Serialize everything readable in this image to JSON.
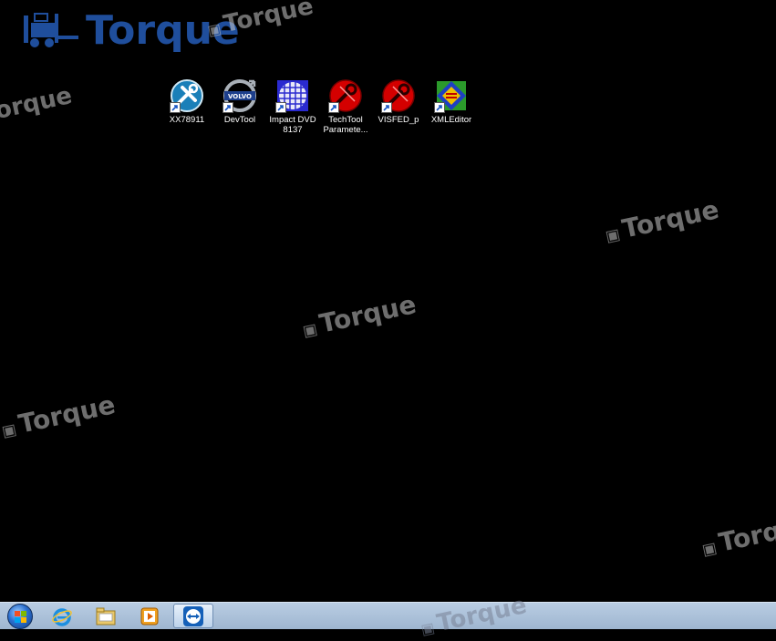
{
  "desktop": {
    "icons": [
      {
        "label": "XX78911",
        "icon": "tools-icon"
      },
      {
        "label": "DevTool",
        "icon": "volvo-icon",
        "badge": "VOLVO"
      },
      {
        "label": "Impact DVD 8137",
        "icon": "grid-globe-icon"
      },
      {
        "label": "TechTool Paramete...",
        "icon": "red-wrench-icon"
      },
      {
        "label": "VISFED_p",
        "icon": "red-wrench-icon"
      },
      {
        "label": "XMLEditor",
        "icon": "xml-editor-icon"
      }
    ]
  },
  "watermark": {
    "text": "Torque",
    "logo_text": "Torque"
  },
  "taskbar": {
    "pinned": [
      {
        "name": "start-orb-icon"
      },
      {
        "name": "internet-explorer-icon"
      },
      {
        "name": "file-explorer-icon"
      },
      {
        "name": "media-player-icon"
      },
      {
        "name": "teamviewer-icon"
      }
    ]
  },
  "colors": {
    "desktop_bg": "#000000",
    "taskbar": "#a9bfd8",
    "logo_blue": "#1f4e9c"
  }
}
